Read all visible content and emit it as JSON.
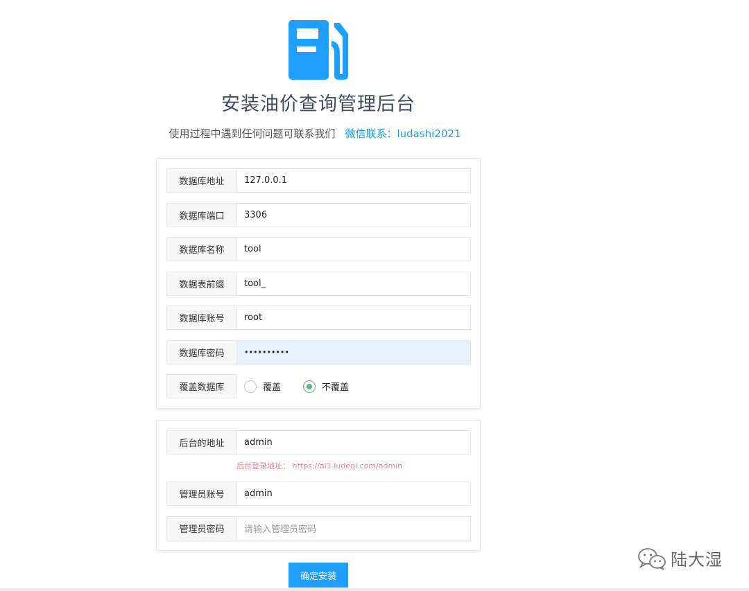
{
  "header": {
    "title": "安装油价查询管理后台",
    "subtitle": "使用过程中遇到任何问题可联系我们",
    "wechat": "微信联系：ludashi2021",
    "logo_icon": "fuel-pump-icon",
    "accent_color": "#1e9fff"
  },
  "db_form": {
    "rows": [
      {
        "label": "数据库地址",
        "value": "127.0.0.1"
      },
      {
        "label": "数据库端口",
        "value": "3306"
      },
      {
        "label": "数据库名称",
        "value": "tool"
      },
      {
        "label": "数据表前缀",
        "value": "tool_"
      },
      {
        "label": "数据库账号",
        "value": "root"
      },
      {
        "label": "数据库密码",
        "value": "••••••••••"
      }
    ],
    "overwrite": {
      "label": "覆盖数据库",
      "option_yes": "覆盖",
      "option_no": "不覆盖",
      "selected": "不覆盖"
    }
  },
  "admin_form": {
    "backend_label": "后台的地址",
    "backend_value": "admin",
    "hint": "后台登录地址： https://ai1.ludeqi.com/admin",
    "account_label": "管理员账号",
    "account_value": "admin",
    "password_label": "管理员密码",
    "password_placeholder": "请输入管理员密码"
  },
  "submit_label": "确定安装",
  "watermark": "陆大湿"
}
